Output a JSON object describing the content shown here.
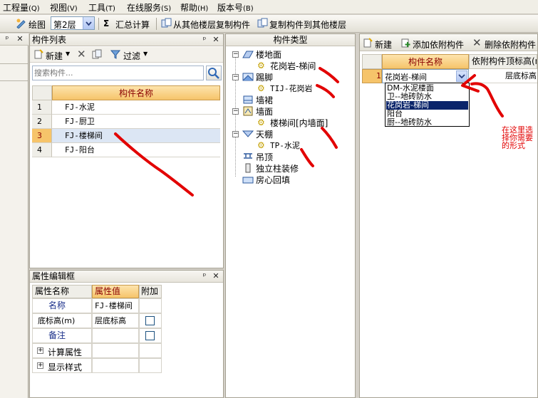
{
  "menubar": {
    "items": [
      "工程量",
      "视图",
      "工具",
      "在线服务",
      "帮助",
      "版本号"
    ],
    "hotkeys": [
      "(Q)",
      "(V)",
      "(T)",
      "(S)",
      "(H)",
      "(B)"
    ]
  },
  "toolbar": {
    "draw_label": "绘图",
    "floor_value": "第2层",
    "sum_label": "汇总计算",
    "copy_from_floor_label": "从其他楼层复制构件",
    "copy_to_floor_label": "复制构件到其他楼层"
  },
  "component_list": {
    "title": "构件列表",
    "new_label": "新建",
    "filter_label": "过滤",
    "search_placeholder": "搜索构件...",
    "column_header": "构件名称",
    "rows": [
      {
        "num": "1",
        "name": "FJ-水泥"
      },
      {
        "num": "2",
        "name": "FJ-厨卫"
      },
      {
        "num": "3",
        "name": "FJ-楼梯间"
      },
      {
        "num": "4",
        "name": "FJ-阳台"
      }
    ]
  },
  "component_types": {
    "title": "构件类型",
    "tree": [
      {
        "label": "楼地面",
        "toggle": "−",
        "children": [
          "花岗岩-梯间"
        ]
      },
      {
        "label": "踢脚",
        "toggle": "−",
        "children": [
          "TIJ-花岗岩"
        ]
      },
      {
        "label": "墙裙",
        "toggle": "",
        "children": []
      },
      {
        "label": "墙面",
        "toggle": "−",
        "children": [
          "楼梯间[内墙面]"
        ]
      },
      {
        "label": "天棚",
        "toggle": "−",
        "children": [
          "TP-水泥"
        ]
      },
      {
        "label": "吊顶",
        "toggle": "",
        "children": []
      },
      {
        "label": "独立柱装修",
        "toggle": "",
        "children": []
      },
      {
        "label": "房心回填",
        "toggle": "",
        "children": []
      }
    ]
  },
  "attached_panel": {
    "new_label": "新建",
    "add_label": "添加依附构件",
    "delete_label": "删除依附构件",
    "col_name": "构件名称",
    "col_height": "依附构件顶标高(m",
    "row_num": "1",
    "row_value": "花岗岩-梯间",
    "row_height": "层底标高",
    "dropdown_options": [
      "DM-水泥楼面",
      "卫--地砖防水",
      "花岗岩-梯间",
      "阳台",
      "厨--地砖防水"
    ],
    "selected_index": 2
  },
  "property_editor": {
    "title": "属性编辑框",
    "col_name": "属性名称",
    "col_value": "属性值",
    "col_extra": "附加",
    "rows": [
      {
        "name": "名称",
        "value": "FJ-楼梯间",
        "expand": ""
      },
      {
        "name": "底标高(m)",
        "value": "层底标高",
        "expand": ""
      },
      {
        "name": "备注",
        "value": "",
        "expand": ""
      },
      {
        "name": "计算属性",
        "value": "",
        "expand": "+"
      },
      {
        "name": "显示样式",
        "value": "",
        "expand": "+"
      }
    ]
  },
  "annotation": {
    "lines": [
      "在这里选",
      "择你需要",
      "的形式"
    ]
  },
  "colors": {
    "header_text": "#8a0000",
    "annotation": "#e20000",
    "selected_row": "#dce6f4",
    "dropdown_selected": "#0a246a"
  }
}
